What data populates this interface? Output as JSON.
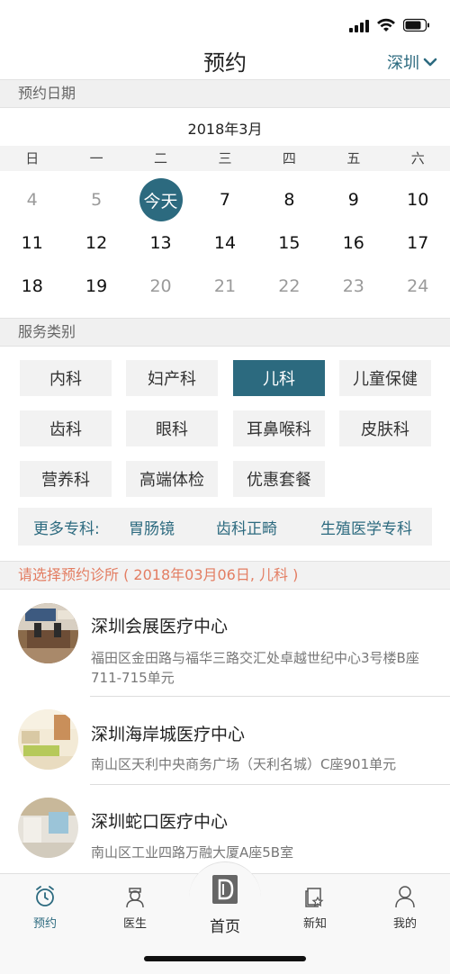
{
  "header": {
    "title": "预约",
    "city": "深圳"
  },
  "date_section": {
    "label": "预约日期",
    "month": "2018年3月"
  },
  "weekdays": [
    "日",
    "一",
    "二",
    "三",
    "四",
    "五",
    "六"
  ],
  "calendar_rows": [
    [
      "4",
      "5",
      "今天",
      "7",
      "8",
      "9",
      "10"
    ],
    [
      "11",
      "12",
      "13",
      "14",
      "15",
      "16",
      "17"
    ],
    [
      "18",
      "19",
      "20",
      "21",
      "22",
      "23",
      "24"
    ]
  ],
  "service_section": {
    "label": "服务类别"
  },
  "services": [
    "内科",
    "妇产科",
    "儿科",
    "儿童保健",
    "齿科",
    "眼科",
    "耳鼻喉科",
    "皮肤科",
    "营养科",
    "高端体检",
    "优惠套餐"
  ],
  "selected_service": "儿科",
  "more": {
    "label": "更多专科:",
    "links": [
      "胃肠镜",
      "齿科正畸",
      "生殖医学专科"
    ]
  },
  "clinic_prompt": "请选择预约诊所 ( 2018年03月06日, 儿科 )",
  "clinics": [
    {
      "name": "深圳会展医疗中心",
      "address": "福田区金田路与福华三路交汇处卓越世纪中心3号楼B座711-715单元"
    },
    {
      "name": "深圳海岸城医疗中心",
      "address": "南山区天利中央商务广场（天利名城）C座901单元"
    },
    {
      "name": "深圳蛇口医疗中心",
      "address": "南山区工业四路万融大厦A座5B室"
    }
  ],
  "tabs": {
    "appointment": "预约",
    "doctor": "医生",
    "home": "首页",
    "news": "新知",
    "mine": "我的"
  },
  "colors": {
    "accent": "#2c6a7f",
    "highlight": "#e37d62"
  }
}
